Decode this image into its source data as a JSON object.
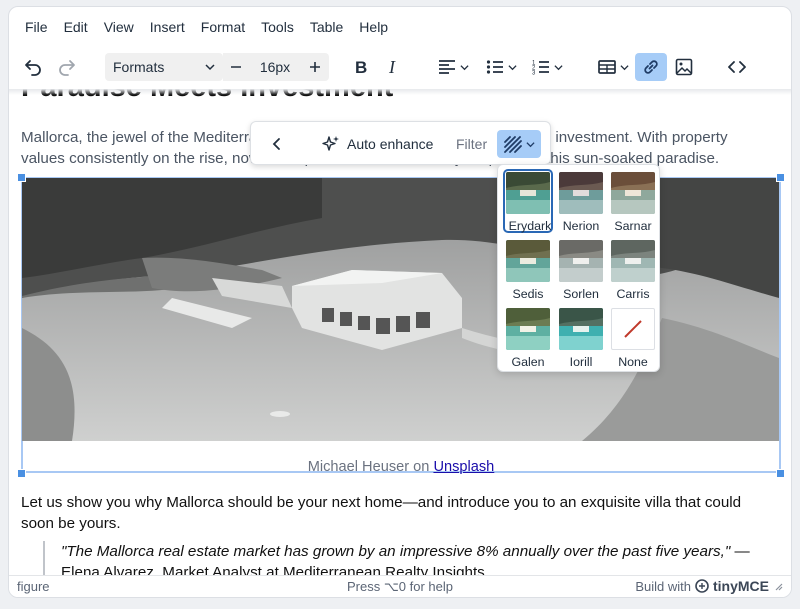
{
  "menubar": {
    "items": [
      "File",
      "Edit",
      "View",
      "Insert",
      "Format",
      "Tools",
      "Table",
      "Help"
    ]
  },
  "toolbar": {
    "formats_label": "Formats",
    "font_size": "16px",
    "link_active_color": "#a6ccf7"
  },
  "content": {
    "heading": "Paradise Meets Investment",
    "para1": "Mallorca, the jewel of the Mediterranean, is not just a paradise but also a smart investment. With property values consistently on the rise, now is the perfect time to secure your piece of this sun-soaked paradise.",
    "caption_prefix": "Michael Heuser on ",
    "caption_link": "Unsplash",
    "para2": "Let us show you why Mallorca should be your next home—and introduce you to an exquisite villa that could soon be yours.",
    "quote_text": "\"The Mallorca real estate market has grown by an impressive 8% annually over the past five years,\"",
    "quote_attribution": " — Elena Alvarez, Market Analyst at Mediterranean Realty Insights."
  },
  "context_toolbar": {
    "auto_enhance": "Auto enhance",
    "filter_label": "Filter"
  },
  "filters": {
    "items": [
      "Erydark",
      "Nerion",
      "Sarnar",
      "Sedis",
      "Sorlen",
      "Carris",
      "Galen",
      "Iorill",
      "None"
    ],
    "selected": "Erydark"
  },
  "statusbar": {
    "path": "figure",
    "help": "Press ⌥0 for help",
    "brand_prefix": "Build with",
    "brand_name": "tinyMCE"
  }
}
